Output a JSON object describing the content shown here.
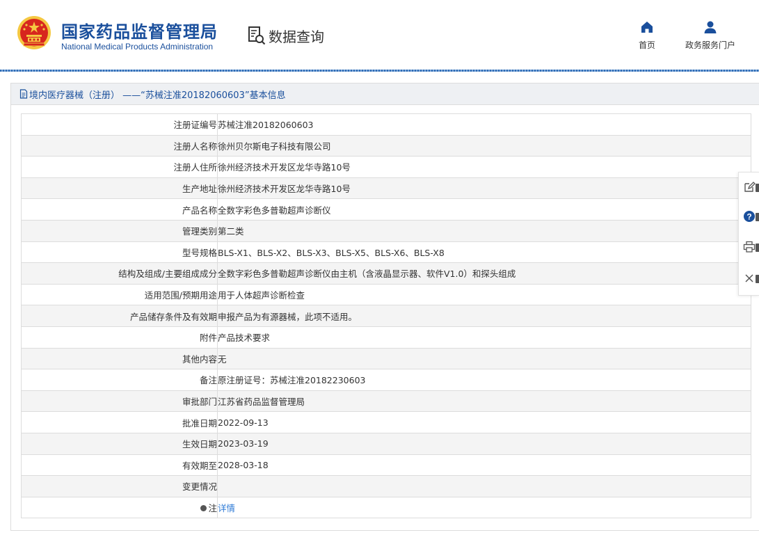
{
  "header": {
    "title_cn": "国家药品监督管理局",
    "title_en": "National Medical Products Administration",
    "query_label": "数据查询",
    "nav": [
      {
        "label": "首页",
        "icon": "home-icon"
      },
      {
        "label": "政务服务门户",
        "icon": "user-icon"
      }
    ]
  },
  "panel": {
    "title": "境内医疗器械（注册） ——“苏械注准20182060603”基本信息"
  },
  "table": {
    "rows": [
      {
        "label": "注册证编号",
        "value": "苏械注准20182060603"
      },
      {
        "label": "注册人名称",
        "value": "徐州贝尔斯电子科技有限公司"
      },
      {
        "label": "注册人住所",
        "value": "徐州经济技术开发区龙华寺路10号"
      },
      {
        "label": "生产地址",
        "value": "徐州经济技术开发区龙华寺路10号"
      },
      {
        "label": "产品名称",
        "value": "全数字彩色多普勒超声诊断仪"
      },
      {
        "label": "管理类别",
        "value": "第二类"
      },
      {
        "label": "型号规格",
        "value": "BLS-X1、BLS-X2、BLS-X3、BLS-X5、BLS-X6、BLS-X8"
      },
      {
        "label": "结构及组成/主要组成成分",
        "value": "全数字彩色多普勒超声诊断仪由主机（含液晶显示器、软件V1.0）和探头组成"
      },
      {
        "label": "适用范围/预期用途",
        "value": "用于人体超声诊断检查"
      },
      {
        "label": "产品储存条件及有效期",
        "value": "申报产品为有源器械，此项不适用。"
      },
      {
        "label": "附件",
        "value": "产品技术要求"
      },
      {
        "label": "其他内容",
        "value": "无"
      },
      {
        "label": "备注",
        "value": "原注册证号：苏械注准20182230603"
      },
      {
        "label": "审批部门",
        "value": "江苏省药品监督管理局"
      },
      {
        "label": "批准日期",
        "value": "2022-09-13"
      },
      {
        "label": "生效日期",
        "value": "2023-03-19"
      },
      {
        "label": "有效期至",
        "value": "2028-03-18"
      },
      {
        "label": "变更情况",
        "value": ""
      }
    ],
    "note_label": "注",
    "note_link": "详情"
  },
  "side_tools": [
    "edit-icon",
    "help-icon",
    "print-icon",
    "close-icon"
  ],
  "colors": {
    "brand": "#1a4f9c",
    "link": "#2f7bd6",
    "emblem_red": "#d7261e",
    "emblem_gold": "#f5c842"
  }
}
